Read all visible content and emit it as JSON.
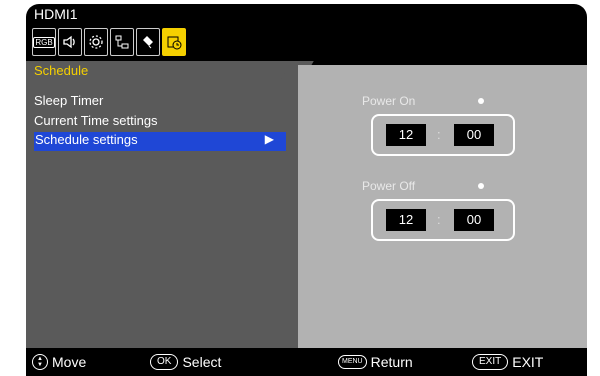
{
  "header": {
    "input_name": "HDMI1"
  },
  "icons": [
    {
      "name": "picture-rgb-icon",
      "glyph": "RGB"
    },
    {
      "name": "audio-speaker-icon",
      "glyph": "🔊"
    },
    {
      "name": "settings-gear-icon",
      "glyph": "⚙"
    },
    {
      "name": "network-icon",
      "glyph": "⧉"
    },
    {
      "name": "usb-icon",
      "glyph": "✎"
    },
    {
      "name": "schedule-icon",
      "glyph": "📅"
    }
  ],
  "menu": {
    "tab_title": "Schedule",
    "items": [
      {
        "label": "Sleep Timer"
      },
      {
        "label": "Current Time settings"
      },
      {
        "label": "Schedule settings",
        "selected": true,
        "arrow": "▶"
      }
    ]
  },
  "power_on": {
    "label": "Power On",
    "hour": "12",
    "sep": ":",
    "minute": "00"
  },
  "power_off": {
    "label": "Power Off",
    "hour": "12",
    "sep": ":",
    "minute": "00"
  },
  "footer": {
    "move": "Move",
    "ok_key": "OK",
    "select": "Select",
    "menu_key": "MENU",
    "return": "Return",
    "exit_key": "EXIT",
    "exit": "EXIT"
  },
  "colors": {
    "accent_yellow": "#f5d000",
    "selection_blue": "#1f47d6",
    "panel_gray": "#5a5a5a",
    "right_gray": "#b2b2b2"
  }
}
